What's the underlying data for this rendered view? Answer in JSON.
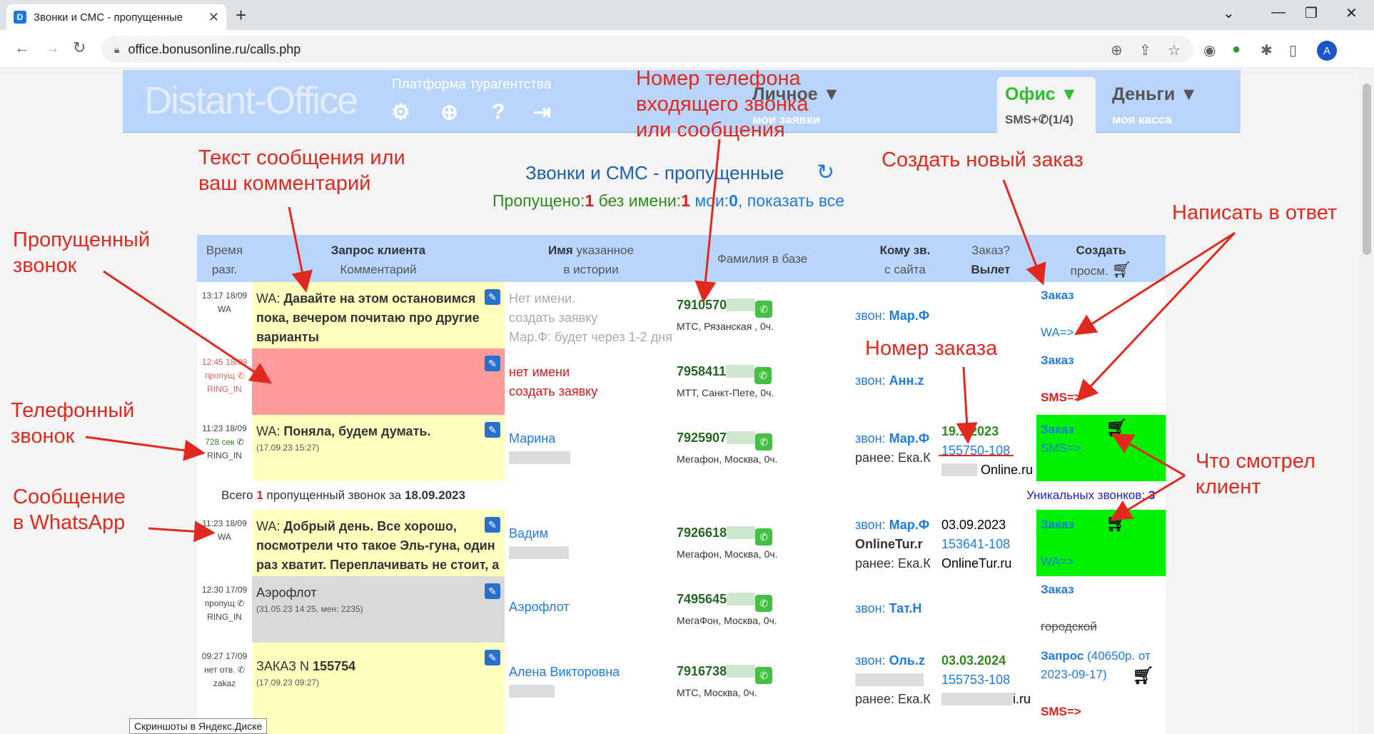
{
  "browser": {
    "tab_title": "Звонки и СМС - пропущенные",
    "tab_favicon": "D",
    "url": "office.bonusonline.ru/calls.php",
    "avatar": "A"
  },
  "header": {
    "logo": "Distant-Office",
    "platform": "Платформа турагентства",
    "menus": [
      {
        "label": "Личное ▼",
        "sub": "мои заявки"
      },
      {
        "label": "Офис ▼",
        "sub": "SMS+✆(1/4)"
      },
      {
        "label": "Деньги ▼",
        "sub": "моя касса"
      }
    ]
  },
  "page": {
    "title": "Звонки и СМС - пропущенные",
    "summary_missed_label": "Пропущено:",
    "summary_missed": "1",
    "summary_noname_label": " без имени:",
    "summary_noname": "1",
    "summary_mine_label": " мои:",
    "summary_mine": "0",
    "summary_showall": ", показать все"
  },
  "table": {
    "headers": {
      "time": "Время разг.",
      "request_bold": "Запрос клиента",
      "request_sub": "Комментарий",
      "name_bold": "Имя",
      "name_rest": " указанное",
      "name_sub": "в истории",
      "surname": "Фамилия в базе",
      "who_bold": "Кому зв.",
      "who_sub": "с сайта",
      "order": "Заказ?",
      "order_sub": "Вылет",
      "create": "Создать",
      "create_sub": "просм."
    },
    "rows": [
      {
        "time": "13:17 18/09",
        "type": "WA",
        "type2": "",
        "q_prefix": "WA: ",
        "q_bold": "Давайте на этом остановимся пока, вечером почитаю про другие варианты",
        "q_small": "",
        "name1": "Нет имени.",
        "name2": "создать заявку",
        "name3": "Мар.Ф: будет через 1-2 дня",
        "phone": "7910570",
        "op": "МТС, Рязанская , 0ч.",
        "who_label": "звон: ",
        "who": "Мар.Ф",
        "who2": "",
        "who3": "",
        "ord_date": "",
        "ord_num": "",
        "ord_site": "",
        "cr1": "Заказ",
        "cr2": "WA=>"
      },
      {
        "time": "12:45 18/09",
        "type": "пропущ",
        "type2": "RING_IN",
        "q_prefix": "",
        "q_bold": "",
        "q_small": "",
        "q_tag": "7-0",
        "name1": "нет имени",
        "name2": "создать заявку",
        "name3": "",
        "phone": "7958411",
        "op": "МТТ, Санкт-Пете, 0ч.",
        "who_label": "звон: ",
        "who": "Анн.z",
        "who2": "",
        "who3": "",
        "ord_date": "",
        "ord_num": "",
        "ord_site": "",
        "cr1": "Заказ",
        "cr2": "SMS=>"
      },
      {
        "time": "11:23 18/09",
        "type": "728 сек",
        "type2": "RING_IN",
        "q_prefix": "WA: ",
        "q_bold": "Поняла, будем думать.",
        "q_small": "(17.09.23 15:27)",
        "name1": "Марина",
        "name2": "",
        "name3": "",
        "phone": "7925907",
        "op": "Мегафон, Москва, 0ч.",
        "who_label": "звон: ",
        "who": "Мар.Ф",
        "who2": "",
        "who3": "ранее: Ека.К",
        "ord_date": "19.1.2023",
        "ord_num": "155750-108",
        "ord_site": "Online.ru",
        "cr1": "Заказ",
        "cr2": "SMS=>"
      },
      {
        "time": "11:23 18/09",
        "type": "WA",
        "type2": "",
        "q_prefix": "WA: ",
        "q_bold": "Добрый день. Все хорошо, посмотрели что такое Эль-гуна, один раз хватит. Переплачивать не стоит, а",
        "q_small": "",
        "name1": "Вадим",
        "name2": "",
        "name3": "",
        "phone": "7926618",
        "op": "Мегафон, Москва, 0ч.",
        "who_label": "звон: ",
        "who": "Мар.Ф",
        "who2": "OnlineTur.r",
        "who3": "ранее: Ека.К",
        "ord_date": "03.09.2023",
        "ord_num": "153641-108",
        "ord_site": "OnlineTur.ru",
        "cr1": "Заказ",
        "cr2": "WA=>"
      },
      {
        "time": "12:30 17/09",
        "type": "пропущ",
        "type2": "RING_IN",
        "q_prefix": "",
        "q_bold": "",
        "q_plain": "Аэрофлот",
        "q_small": "(31.05.23 14:25, мен: 2235)",
        "name1": "Аэрофлот",
        "name2": "",
        "name3": "",
        "phone": "7495645",
        "op": "МегаФон, Москва, 0ч.",
        "who_label": "звон: ",
        "who": "Тат.Н",
        "who2": "",
        "who3": "",
        "ord_date": "",
        "ord_num": "",
        "ord_site": "",
        "cr1": "Заказ",
        "cr2": "городской"
      },
      {
        "time": "09:27 17/09",
        "type": "нет отв.",
        "type2": "zakaz",
        "q_prefix": "",
        "q_bold": "155754",
        "q_plain": "ЗАКАЗ N ",
        "q_small": "(17.09.23 09:27)",
        "name1": "Алена Викторовна",
        "name2": "",
        "name3": "",
        "phone": "7916738",
        "op": "МТС, Москва, 0ч.",
        "who_label": "звон: ",
        "who": "Оль.z",
        "who2": "",
        "who3": "ранее: Ека.К",
        "ord_date": "03.03.2024",
        "ord_num": "155753-108",
        "ord_site": "i.ru",
        "cr1": "Запрос",
        "cr1b": " (40650р. от 2023-09-17)",
        "cr2": "SMS=>"
      }
    ],
    "divider_prefix": "Всего ",
    "divider_count": "1",
    "divider_mid": " пропущенный звонок за ",
    "divider_date": "18.09.2023",
    "unique_label": "Уникальных звонков: ",
    "unique_count": "3"
  },
  "annotations": {
    "phone_note": "Номер телефона\nвходящего звонка\nили сообщения",
    "text_note": "Текст сообщения или\nваш комментарий",
    "create_note": "Создать новый заказ",
    "reply_note": "Написать в ответ",
    "missed_note": "Пропущенный\nзвонок",
    "order_note": "Номер заказа",
    "phonecall_note": "Телефонный\nзвонок",
    "viewed_note": "Что смотрел\nклиент",
    "wa_note": "Сообщение\nв WhatsApp"
  },
  "tooltip": "Скриншоты в Яндекс.Диске",
  "colors": {
    "accent": "#1e7be6",
    "header": "#b9d5fb",
    "annotation": "#e0291f",
    "wa_cell": "#ffffc0",
    "missed_cell": "#ff9a9a",
    "grey_cell": "#d9d9d9",
    "green_cell": "#00f000"
  }
}
